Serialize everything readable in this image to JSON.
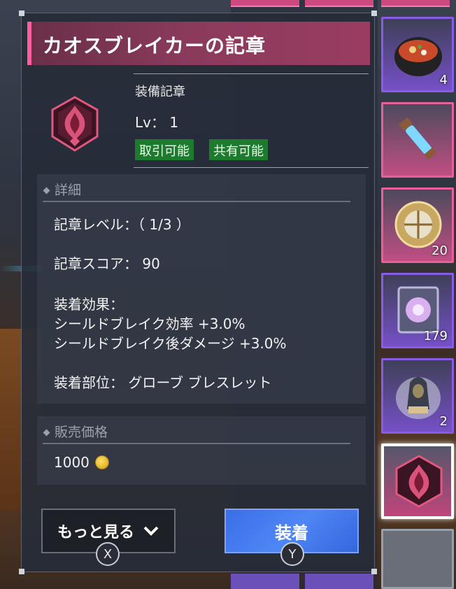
{
  "item": {
    "name": "カオスブレイカーの記章",
    "type": "装備記章",
    "level": "Lv：  1",
    "tags": [
      "取引可能",
      "共有可能"
    ]
  },
  "details": {
    "header": "詳細",
    "badge_level": "記章レベル：（ 1/3 ）",
    "badge_score": "記章スコア：  90",
    "effect_header": "装着効果：",
    "effects": [
      "シールドブレイク効率 +3.0%",
      "シールドブレイク後ダメージ +3.0%"
    ],
    "slots": "装着部位：  グローブ  ブレスレット"
  },
  "sale": {
    "header": "販売価格",
    "price": "1000"
  },
  "buttons": {
    "more": "もっと見る",
    "more_hint": "X",
    "equip": "装着",
    "equip_hint": "Y"
  },
  "inventory": [
    {
      "qty": "4",
      "icon": "stew-pot-icon",
      "rarity": "purple"
    },
    {
      "qty": "",
      "icon": "potion-vial-icon",
      "rarity": "pink"
    },
    {
      "qty": "20",
      "icon": "astrolabe-icon",
      "rarity": "pink"
    },
    {
      "qty": "179",
      "icon": "spellbook-icon",
      "rarity": "purple"
    },
    {
      "qty": "2",
      "icon": "hooded-statue-icon",
      "rarity": "purple"
    },
    {
      "qty": "",
      "icon": "chaos-badge-icon",
      "rarity": "selected"
    },
    {
      "qty": "",
      "icon": "empty-slot",
      "rarity": "gray"
    }
  ],
  "colors": {
    "accent_pink": "#ff5f9e",
    "tag_green": "#1d7a2e",
    "equip_blue": "#4f86f5"
  }
}
